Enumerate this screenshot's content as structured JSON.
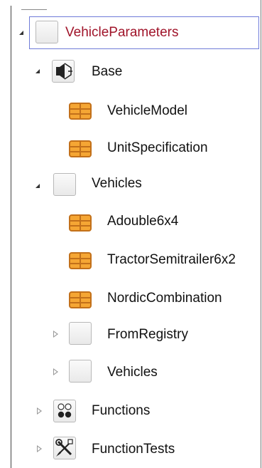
{
  "tree": {
    "root": {
      "label": "VehicleParameters",
      "icon": "block-icon",
      "expanded": true,
      "selected": true
    },
    "base": {
      "label": "Base",
      "icon": "speaker-block-icon",
      "expanded": true,
      "children": [
        {
          "label": "VehicleModel",
          "icon": "table-icon"
        },
        {
          "label": "UnitSpecification",
          "icon": "table-icon"
        }
      ]
    },
    "vehicles": {
      "label": "Vehicles",
      "icon": "block-icon",
      "expanded": true,
      "children": [
        {
          "label": "Adouble6x4",
          "icon": "table-icon"
        },
        {
          "label": "TractorSemitrailer6x2",
          "icon": "table-icon"
        },
        {
          "label": "NordicCombination",
          "icon": "table-icon"
        },
        {
          "label": "FromRegistry",
          "icon": "block-icon",
          "expanded": false
        },
        {
          "label": "Vehicles",
          "icon": "block-icon",
          "expanded": false
        }
      ]
    },
    "functions": {
      "label": "Functions",
      "icon": "dots-block-icon",
      "expanded": false
    },
    "function_tests": {
      "label": "FunctionTests",
      "icon": "tools-block-icon",
      "expanded": false
    }
  },
  "colors": {
    "selected_text": "#a0142a",
    "selection_border": "#6f7bd8",
    "table_icon": "#f0a030",
    "table_icon_border": "#c06a10"
  }
}
